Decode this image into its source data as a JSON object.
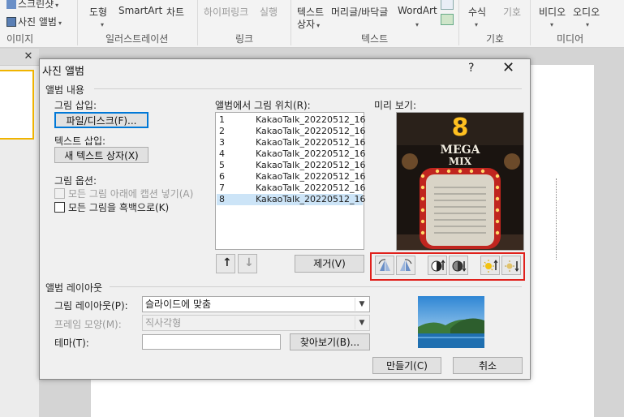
{
  "ribbon": {
    "screenshot": "스크린샷",
    "photo_album": "사진 앨범",
    "shapes": "도형",
    "smartart": "SmartArt",
    "chart": "차트",
    "hyperlink": "하이퍼링크",
    "action": "실행",
    "textbox_line1": "텍스트",
    "textbox_line2": "상자",
    "header_footer": "머리글/바닥글",
    "wordart": "WordArt",
    "equation": "수식",
    "symbol": "기호",
    "video": "비디오",
    "audio": "오디오",
    "groups": {
      "images": "이미지",
      "illustrations": "일러스트레이션",
      "links": "링크",
      "text": "텍스트",
      "symbols": "기호",
      "media": "미디어"
    }
  },
  "dialog": {
    "title": "사진 앨범",
    "help": "?",
    "close": "✕",
    "album_content": "앨범 내용",
    "insert_picture": "그림 삽입:",
    "file_disk_button": "파일/디스크(F)...",
    "insert_text": "텍스트 삽입:",
    "new_textbox_button": "새 텍스트 상자(X)",
    "picture_options": "그림 옵션:",
    "captions_label": "모든 그림 아래에 캡션 넣기(A)",
    "bw_label": "모든 그림을 흑백으로(K)",
    "pictures_in_album": "앨범에서 그림 위치(R):",
    "preview": "미리 보기:",
    "pictures": [
      {
        "num": "1",
        "name": "KakaoTalk_20220512_16"
      },
      {
        "num": "2",
        "name": "KakaoTalk_20220512_16"
      },
      {
        "num": "3",
        "name": "KakaoTalk_20220512_16"
      },
      {
        "num": "4",
        "name": "KakaoTalk_20220512_16"
      },
      {
        "num": "5",
        "name": "KakaoTalk_20220512_16"
      },
      {
        "num": "6",
        "name": "KakaoTalk_20220512_16"
      },
      {
        "num": "7",
        "name": "KakaoTalk_20220512_16"
      },
      {
        "num": "8",
        "name": "KakaoTalk_20220512_16"
      }
    ],
    "selected_index": 8,
    "remove_button": "제거(V)",
    "move_up": "↑",
    "move_down": "↓",
    "preview_sign_number": "8",
    "preview_sign_text1": "MEGA",
    "preview_sign_text2": "MIX",
    "album_layout": "앨범 레이아웃",
    "picture_layout_label": "그림 레이아웃(P):",
    "picture_layout_value": "슬라이드에 맞춤",
    "frame_shape_label": "프레임 모양(M):",
    "frame_shape_value": "직사각형",
    "theme_label": "테마(T):",
    "theme_value": "",
    "browse_button": "찾아보기(B)...",
    "create_button": "만들기(C)",
    "cancel_button": "취소"
  },
  "colors": {
    "highlight_box": "#e0201b",
    "selection": "#cce4f7",
    "focus": "#0078d7"
  }
}
